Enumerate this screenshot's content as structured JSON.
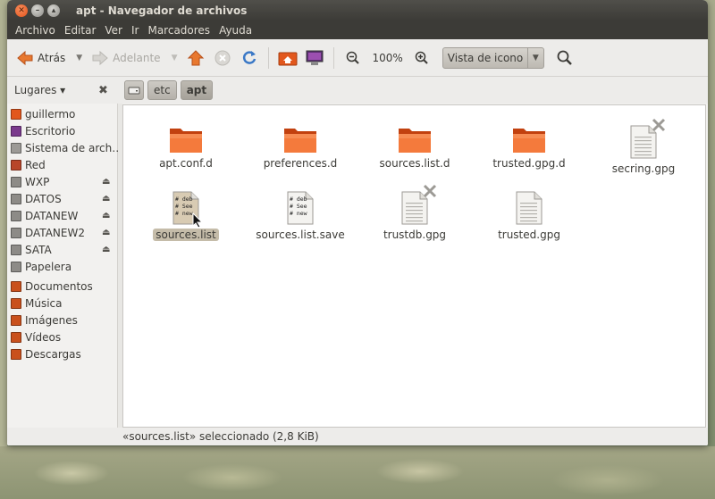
{
  "window": {
    "title": "apt - Navegador de archivos"
  },
  "menu": [
    "Archivo",
    "Editar",
    "Ver",
    "Ir",
    "Marcadores",
    "Ayuda"
  ],
  "toolbar": {
    "back_label": "Atrás",
    "forward_label": "Adelante",
    "zoom": "100%",
    "view_mode": "Vista de icono"
  },
  "places": {
    "label": "Lugares ▾"
  },
  "breadcrumbs": [
    "etc",
    "apt"
  ],
  "sidebar": {
    "items": [
      {
        "label": "guillermo",
        "icon": "home-folder-icon",
        "color": "#e2571c"
      },
      {
        "label": "Escritorio",
        "icon": "desktop-folder-icon",
        "color": "#7a3a8c"
      },
      {
        "label": "Sistema de arch…",
        "icon": "filesystem-icon",
        "color": "#9c9a96"
      },
      {
        "label": "Red",
        "icon": "network-icon",
        "color": "#b8462a"
      },
      {
        "label": "WXP",
        "icon": "drive-icon",
        "color": "#8d8b87",
        "eject": true
      },
      {
        "label": "DATOS",
        "icon": "drive-icon",
        "color": "#8d8b87",
        "eject": true
      },
      {
        "label": "DATANEW",
        "icon": "drive-icon",
        "color": "#8d8b87",
        "eject": true
      },
      {
        "label": "DATANEW2",
        "icon": "drive-icon",
        "color": "#8d8b87",
        "eject": true
      },
      {
        "label": "SATA",
        "icon": "usb-drive-icon",
        "color": "#8d8b87",
        "eject": true
      },
      {
        "label": "Papelera",
        "icon": "trash-icon",
        "color": "#8d8b87"
      },
      {
        "label": "Documentos",
        "icon": "documents-folder-icon",
        "color": "#c9501c"
      },
      {
        "label": "Música",
        "icon": "music-folder-icon",
        "color": "#c9501c"
      },
      {
        "label": "Imágenes",
        "icon": "pictures-folder-icon",
        "color": "#c9501c"
      },
      {
        "label": "Vídeos",
        "icon": "videos-folder-icon",
        "color": "#c9501c"
      },
      {
        "label": "Descargas",
        "icon": "downloads-folder-icon",
        "color": "#c9501c"
      }
    ]
  },
  "files": [
    {
      "name": "apt.conf.d",
      "type": "folder"
    },
    {
      "name": "preferences.d",
      "type": "folder"
    },
    {
      "name": "sources.list.d",
      "type": "folder"
    },
    {
      "name": "trusted.gpg.d",
      "type": "folder"
    },
    {
      "name": "secring.gpg",
      "type": "locked-document"
    },
    {
      "name": "sources.list",
      "type": "text",
      "selected": true,
      "preview": [
        "# deb",
        "# See",
        "# new"
      ]
    },
    {
      "name": "sources.list.save",
      "type": "text",
      "preview": [
        "# deb",
        "# See",
        "# new"
      ]
    },
    {
      "name": "trustdb.gpg",
      "type": "locked-document"
    },
    {
      "name": "trusted.gpg",
      "type": "document"
    }
  ],
  "status": "«sources.list» seleccionado (2,8 KiB)",
  "colors": {
    "accent": "#e2571c",
    "titlebar": "#3c3b37",
    "selection": "#c5bca9"
  }
}
